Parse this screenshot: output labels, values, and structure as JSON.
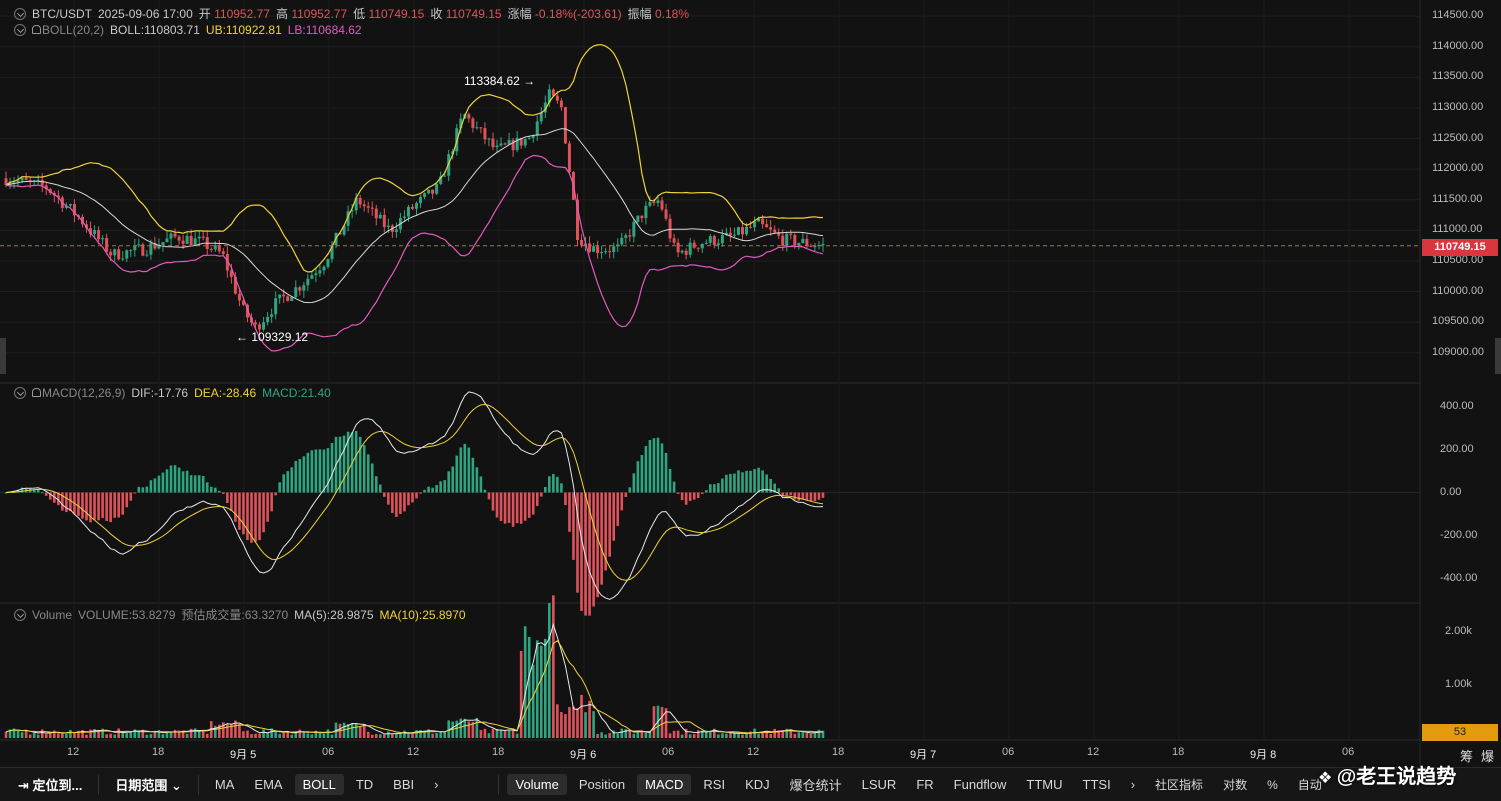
{
  "header": {
    "symbol": "BTC/USDT",
    "datetime": "2025-09-06 17:00",
    "open_label": "开",
    "open": "110952.77",
    "high_label": "高",
    "high": "110952.77",
    "low_label": "低",
    "low": "110749.15",
    "close_label": "收",
    "close": "110749.15",
    "change_label": "涨幅",
    "change": "-0.18%(-203.61)",
    "amplitude_label": "振幅",
    "amplitude": "0.18%"
  },
  "boll": {
    "name": "BOLL(20,2)",
    "boll": "BOLL:110803.71",
    "ub": "UB:110922.81",
    "lb": "LB:110684.62"
  },
  "macd": {
    "name": "MACD(12,26,9)",
    "dif": "DIF:-17.76",
    "dea": "DEA:-28.46",
    "macd": "MACD:21.40"
  },
  "volume": {
    "name": "Volume",
    "value": "VOLUME:53.8279",
    "est": "预估成交量:63.3270",
    "ma5": "MA(5):28.9875",
    "ma10": "MA(10):25.8970"
  },
  "annotations": {
    "high_mark": "113384.62",
    "low_mark": "109329.12"
  },
  "price_axis": [
    "114500.00",
    "114000.00",
    "113500.00",
    "113000.00",
    "112500.00",
    "112000.00",
    "111500.00",
    "111000.00",
    "110500.00",
    "110000.00",
    "109500.00",
    "109000.00"
  ],
  "current_price": "110749.15",
  "macd_axis": [
    "400.00",
    "200.00",
    "0.00",
    "-200.00",
    "-400.00"
  ],
  "volume_axis": [
    "2.00k",
    "1.00k"
  ],
  "current_volume": "53",
  "time_axis": [
    "12",
    "18",
    "9月 5",
    "06",
    "12",
    "18",
    "9月 6",
    "06",
    "12",
    "18",
    "9月 7",
    "06",
    "12",
    "18",
    "9月 8",
    "06"
  ],
  "toolbar_left": {
    "locate": "定位到...",
    "date_range": "日期范围",
    "indicators": [
      "MA",
      "EMA",
      "BOLL",
      "TD",
      "BBI"
    ]
  },
  "toolbar_right": {
    "indicators": [
      "Volume",
      "Position",
      "MACD",
      "RSI",
      "KDJ",
      "爆仓统计",
      "LSUR",
      "FR",
      "Fundflow",
      "TTMU",
      "TTSI"
    ],
    "extra": [
      "社区指标",
      "对数",
      "%",
      "自动"
    ]
  },
  "corner_labels": [
    "筹",
    "爆"
  ],
  "watermark": "@老王说趋势",
  "colors": {
    "up": "#2ea581",
    "down": "#e0525a",
    "boll_mid": "#d8d8d8",
    "boll_ub": "#f0d23a",
    "boll_lb": "#e15bbd",
    "price_tag": "#d9363e",
    "volume_tag": "#e39a0e"
  },
  "chart_data": {
    "type": "candlestick",
    "interval": "15m",
    "y_range": [
      108800,
      114600
    ],
    "key_points": [
      {
        "t": 0,
        "p": 111850
      },
      {
        "t": 0.05,
        "p": 111700
      },
      {
        "t": 0.09,
        "p": 111200
      },
      {
        "t": 0.13,
        "p": 110600
      },
      {
        "t": 0.17,
        "p": 110700
      },
      {
        "t": 0.21,
        "p": 110900
      },
      {
        "t": 0.24,
        "p": 110800
      },
      {
        "t": 0.265,
        "p": 110600
      },
      {
        "t": 0.29,
        "p": 109700
      },
      {
        "t": 0.305,
        "p": 109400
      },
      {
        "t": 0.33,
        "p": 109800
      },
      {
        "t": 0.36,
        "p": 110100
      },
      {
        "t": 0.39,
        "p": 110500
      },
      {
        "t": 0.41,
        "p": 111000
      },
      {
        "t": 0.43,
        "p": 111500
      },
      {
        "t": 0.47,
        "p": 111000
      },
      {
        "t": 0.5,
        "p": 111400
      },
      {
        "t": 0.53,
        "p": 111700
      },
      {
        "t": 0.56,
        "p": 112900
      },
      {
        "t": 0.6,
        "p": 112300
      },
      {
        "t": 0.64,
        "p": 112500
      },
      {
        "t": 0.665,
        "p": 113200
      },
      {
        "t": 0.68,
        "p": 113000
      },
      {
        "t": 0.7,
        "p": 110900
      },
      {
        "t": 0.72,
        "p": 110700
      },
      {
        "t": 0.75,
        "p": 110700
      },
      {
        "t": 0.78,
        "p": 111300
      },
      {
        "t": 0.8,
        "p": 111500
      },
      {
        "t": 0.82,
        "p": 110600
      },
      {
        "t": 0.85,
        "p": 110800
      },
      {
        "t": 0.89,
        "p": 110900
      },
      {
        "t": 0.92,
        "p": 111100
      },
      {
        "t": 0.95,
        "p": 110850
      },
      {
        "t": 1,
        "p": 110750
      }
    ],
    "macd_range": [
      -500,
      500
    ],
    "volume_max": 2500
  }
}
